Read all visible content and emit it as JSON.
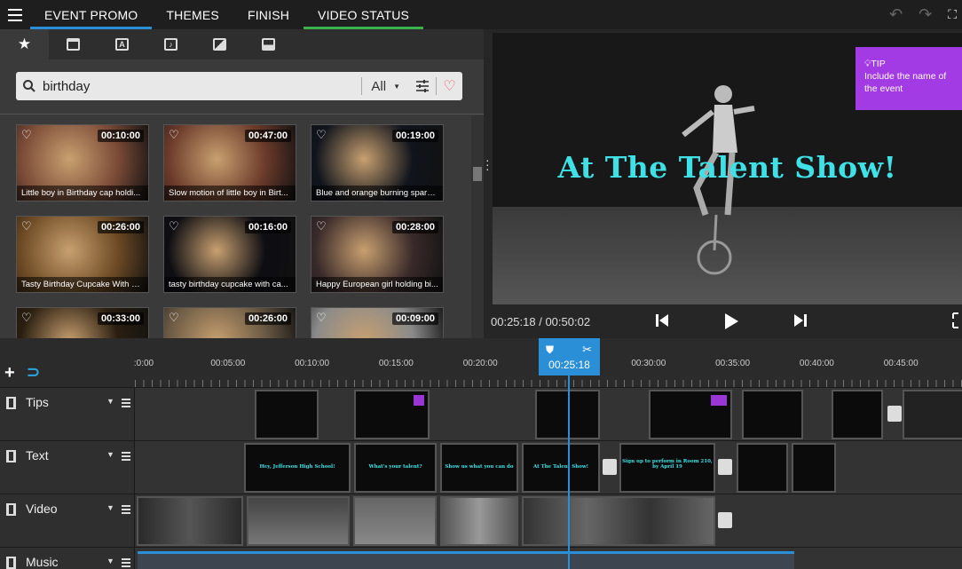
{
  "tabs": [
    {
      "label": "EVENT PROMO",
      "indicator": "blue"
    },
    {
      "label": "THEMES",
      "indicator": ""
    },
    {
      "label": "FINISH",
      "indicator": ""
    },
    {
      "label": "VIDEO STATUS",
      "indicator": "green"
    }
  ],
  "top_icons": [
    "undo-icon",
    "redo-icon",
    "fullscreen-icon"
  ],
  "categories": [
    "favorites-icon",
    "folder-star-icon",
    "text-template-icon",
    "music-icon",
    "transition-icon",
    "image-icon"
  ],
  "search": {
    "value": "birthday",
    "filter": "All"
  },
  "thumbnails": [
    {
      "duration": "00:10:00",
      "caption": "Little boy in Birthday cap holdi...",
      "tone": "#7a4a36"
    },
    {
      "duration": "00:47:00",
      "caption": "Slow motion of little boy in Birt...",
      "tone": "#6b3a2a"
    },
    {
      "duration": "00:19:00",
      "caption": "Blue and orange burning sparkl...",
      "tone": "#10141c"
    },
    {
      "duration": "00:26:00",
      "caption": "Tasty Birthday Cupcake With C...",
      "tone": "#6d4a24"
    },
    {
      "duration": "00:16:00",
      "caption": "tasty birthday cupcake with ca...",
      "tone": "#0d0d12"
    },
    {
      "duration": "00:28:00",
      "caption": "Happy European girl holding bi...",
      "tone": "#3a2a2a"
    },
    {
      "duration": "00:33:00",
      "caption": "",
      "tone": "#2a1e10"
    },
    {
      "duration": "00:26:00",
      "caption": "",
      "tone": "#6b5a44"
    },
    {
      "duration": "00:09:00",
      "caption": "",
      "tone": "#8a8a8a"
    }
  ],
  "preview": {
    "title": "At The Talent Show!",
    "time": "00:25:18 / 00:50:02",
    "tip_label": "TIP",
    "tip_text": "Include the name of the event"
  },
  "timeline": {
    "playhead": "00:25:18",
    "ruler_labels": [
      ":0:00",
      "00:05:00",
      "00:10:00",
      "00:15:00",
      "00:20:00",
      "00:25:00",
      "00:30:00",
      "00:35:00",
      "00:40:00",
      "00:45:00"
    ],
    "tracks": [
      "Tips",
      "Text",
      "Video",
      "Music"
    ],
    "text_clips": [
      "Hey, Jefferson High School!",
      "What's your talent?",
      "Show us what you can do",
      "At The Talent Show!",
      "Sign up to perform in Room 210, by April 19"
    ]
  },
  "colors": {
    "accent": "#2a8fd6",
    "tip": "#a23be3",
    "title": "#3fe0e6",
    "status": "#3cb04a"
  }
}
